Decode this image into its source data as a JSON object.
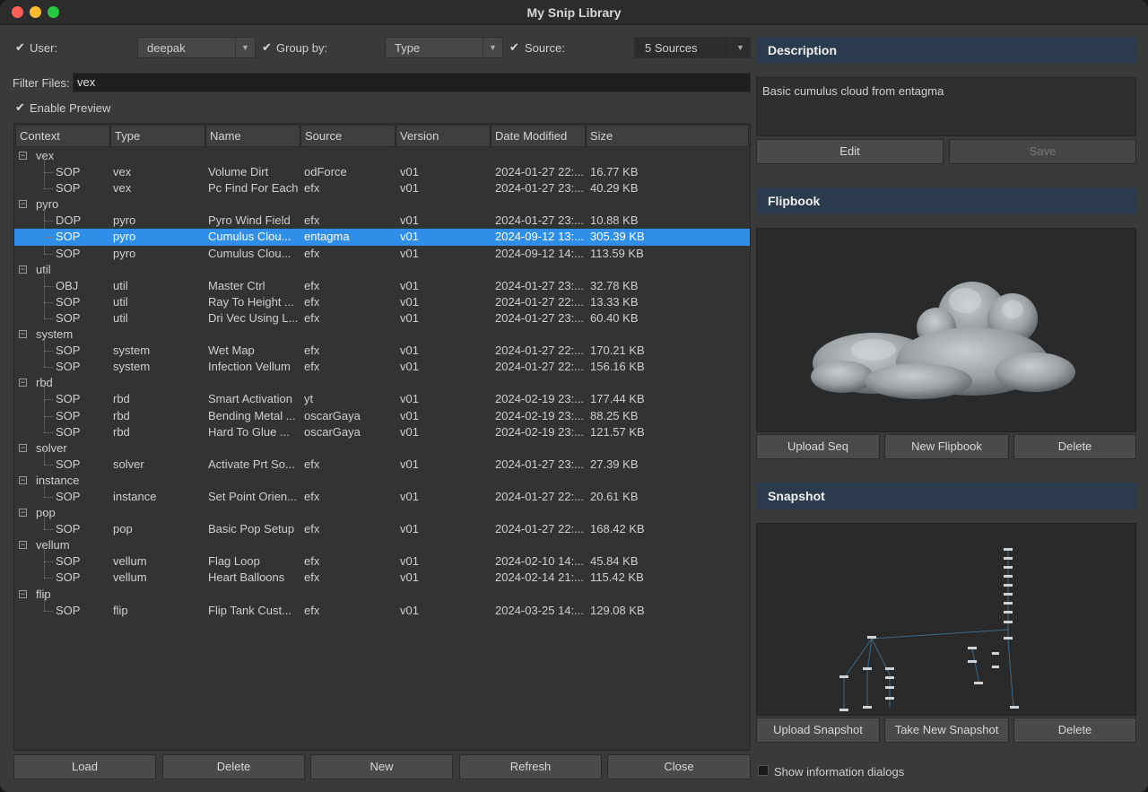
{
  "window": {
    "title": "My Snip Library"
  },
  "filters": {
    "user_label": "User:",
    "user_value": "deepak",
    "group_label": "Group by:",
    "group_value": "Type",
    "source_label": "Source:",
    "source_value": "5 Sources",
    "filter_label": "Filter Files:",
    "filter_value": "vex",
    "preview_label": "Enable Preview",
    "check_glyph": "✔"
  },
  "table": {
    "columns": [
      "Context",
      "Type",
      "Name",
      "Source",
      "Version",
      "Date Modified",
      "Size"
    ],
    "groups": [
      {
        "name": "vex",
        "expander": "−",
        "rows": [
          {
            "context": "SOP",
            "type": "vex",
            "name": "Volume Dirt",
            "source": "odForce",
            "version": "v01",
            "date": "2024-01-27 22:...",
            "size": "16.77 KB"
          },
          {
            "context": "SOP",
            "type": "vex",
            "name": "Pc Find For Each",
            "source": "efx",
            "version": "v01",
            "date": "2024-01-27 23:...",
            "size": "40.29 KB"
          }
        ]
      },
      {
        "name": "pyro",
        "expander": "−",
        "rows": [
          {
            "context": "DOP",
            "type": "pyro",
            "name": "Pyro Wind Field",
            "source": "efx",
            "version": "v01",
            "date": "2024-01-27 23:...",
            "size": "10.88 KB"
          },
          {
            "context": "SOP",
            "type": "pyro",
            "name": "Cumulus Clou...",
            "source": "entagma",
            "version": "v01",
            "date": "2024-09-12 13:...",
            "size": "305.39 KB",
            "selected": true
          },
          {
            "context": "SOP",
            "type": "pyro",
            "name": "Cumulus Clou...",
            "source": "efx",
            "version": "v01",
            "date": "2024-09-12 14:...",
            "size": "113.59 KB"
          }
        ]
      },
      {
        "name": "util",
        "expander": "−",
        "rows": [
          {
            "context": "OBJ",
            "type": "util",
            "name": "Master Ctrl",
            "source": "efx",
            "version": "v01",
            "date": "2024-01-27 23:...",
            "size": "32.78 KB"
          },
          {
            "context": "SOP",
            "type": "util",
            "name": "Ray To Height ...",
            "source": "efx",
            "version": "v01",
            "date": "2024-01-27 22:...",
            "size": "13.33 KB"
          },
          {
            "context": "SOP",
            "type": "util",
            "name": "Dri Vec Using L...",
            "source": "efx",
            "version": "v01",
            "date": "2024-01-27 23:...",
            "size": "60.40 KB"
          }
        ]
      },
      {
        "name": "system",
        "expander": "−",
        "rows": [
          {
            "context": "SOP",
            "type": "system",
            "name": "Wet Map",
            "source": "efx",
            "version": "v01",
            "date": "2024-01-27 22:...",
            "size": "170.21 KB"
          },
          {
            "context": "SOP",
            "type": "system",
            "name": "Infection Vellum",
            "source": "efx",
            "version": "v01",
            "date": "2024-01-27 22:...",
            "size": "156.16 KB"
          }
        ]
      },
      {
        "name": "rbd",
        "expander": "−",
        "rows": [
          {
            "context": "SOP",
            "type": "rbd",
            "name": "Smart Activation",
            "source": "yt",
            "version": "v01",
            "date": "2024-02-19 23:...",
            "size": "177.44 KB"
          },
          {
            "context": "SOP",
            "type": "rbd",
            "name": "Bending Metal ...",
            "source": "oscarGaya",
            "version": "v01",
            "date": "2024-02-19 23:...",
            "size": "88.25 KB"
          },
          {
            "context": "SOP",
            "type": "rbd",
            "name": "Hard To Glue ...",
            "source": "oscarGaya",
            "version": "v01",
            "date": "2024-02-19 23:...",
            "size": "121.57 KB"
          }
        ]
      },
      {
        "name": "solver",
        "expander": "−",
        "rows": [
          {
            "context": "SOP",
            "type": "solver",
            "name": "Activate Prt So...",
            "source": "efx",
            "version": "v01",
            "date": "2024-01-27 23:...",
            "size": "27.39 KB"
          }
        ]
      },
      {
        "name": "instance",
        "expander": "−",
        "rows": [
          {
            "context": "SOP",
            "type": "instance",
            "name": "Set Point Orien...",
            "source": "efx",
            "version": "v01",
            "date": "2024-01-27 22:...",
            "size": "20.61 KB"
          }
        ]
      },
      {
        "name": "pop",
        "expander": "−",
        "rows": [
          {
            "context": "SOP",
            "type": "pop",
            "name": "Basic Pop Setup",
            "source": "efx",
            "version": "v01",
            "date": "2024-01-27 22:...",
            "size": "168.42 KB"
          }
        ]
      },
      {
        "name": "vellum",
        "expander": "−",
        "rows": [
          {
            "context": "SOP",
            "type": "vellum",
            "name": "Flag Loop",
            "source": "efx",
            "version": "v01",
            "date": "2024-02-10 14:...",
            "size": "45.84 KB"
          },
          {
            "context": "SOP",
            "type": "vellum",
            "name": "Heart Balloons",
            "source": "efx",
            "version": "v01",
            "date": "2024-02-14 21:...",
            "size": "115.42 KB"
          }
        ]
      },
      {
        "name": "flip",
        "expander": "−",
        "rows": [
          {
            "context": "SOP",
            "type": "flip",
            "name": "Flip Tank Cust...",
            "source": "efx",
            "version": "v01",
            "date": "2024-03-25 14:...",
            "size": "129.08 KB"
          }
        ]
      }
    ]
  },
  "bottom_buttons": [
    "Load",
    "Delete",
    "New",
    "Refresh",
    "Close"
  ],
  "description": {
    "header": "Description",
    "text": "Basic cumulus cloud from entagma",
    "edit_label": "Edit",
    "save_label": "Save"
  },
  "flipbook": {
    "header": "Flipbook",
    "upload_label": "Upload Seq",
    "new_label": "New Flipbook",
    "delete_label": "Delete"
  },
  "snapshot": {
    "header": "Snapshot",
    "upload_label": "Upload Snapshot",
    "take_label": "Take New Snapshot",
    "delete_label": "Delete"
  },
  "footer": {
    "info_dialogs_label": "Show information dialogs"
  },
  "colors": {
    "selection": "#2f8fe8",
    "panel_header": "#2b3a4d"
  },
  "icons": {
    "combo_arrow": "▼"
  }
}
